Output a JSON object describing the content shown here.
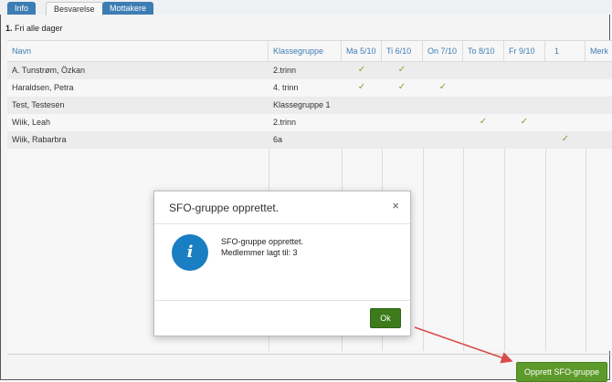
{
  "tabs": [
    {
      "label": "Info"
    },
    {
      "label": "Besvarelse"
    },
    {
      "label": "Mottakere"
    }
  ],
  "question": {
    "number": "1.",
    "text": "Fri alle dager"
  },
  "table": {
    "columns": [
      "Navn",
      "Klassegruppe",
      "Ma 5/10",
      "Ti 6/10",
      "On 7/10",
      "To 8/10",
      "Fr 9/10",
      "1",
      "Merk"
    ],
    "rows": [
      {
        "name": "A. Tunstrøm, Özkan",
        "group": "2.trinn",
        "checks": [
          1,
          1,
          0,
          0,
          0,
          0
        ]
      },
      {
        "name": "Haraldsen, Petra",
        "group": "4. trinn",
        "checks": [
          1,
          1,
          1,
          0,
          0,
          0
        ]
      },
      {
        "name": "Test, Testesen",
        "group": "Klassegruppe 1",
        "checks": [
          0,
          0,
          0,
          0,
          0,
          0
        ]
      },
      {
        "name": "Wiik, Leah",
        "group": "2.trinn",
        "checks": [
          0,
          0,
          0,
          1,
          1,
          0
        ]
      },
      {
        "name": "Wiik, Rabarbra",
        "group": "6a",
        "checks": [
          0,
          0,
          0,
          0,
          0,
          1
        ]
      }
    ],
    "check_glyph": "✓"
  },
  "dialog": {
    "title": "SFO-gruppe opprettet.",
    "close": "×",
    "icon": "i",
    "message_line1": "SFO-gruppe opprettet.",
    "message_line2": "Medlemmer lagt til: 3",
    "ok_label": "Ok"
  },
  "footer": {
    "create_label": "Opprett SFO-gruppe"
  },
  "colors": {
    "accent": "#3d7db4",
    "ok_button": "#3c7a1c",
    "create_button": "#5d9a2c",
    "check": "#7ca632",
    "arrow": "#d94b4b",
    "info_icon": "#1a7ec2"
  }
}
